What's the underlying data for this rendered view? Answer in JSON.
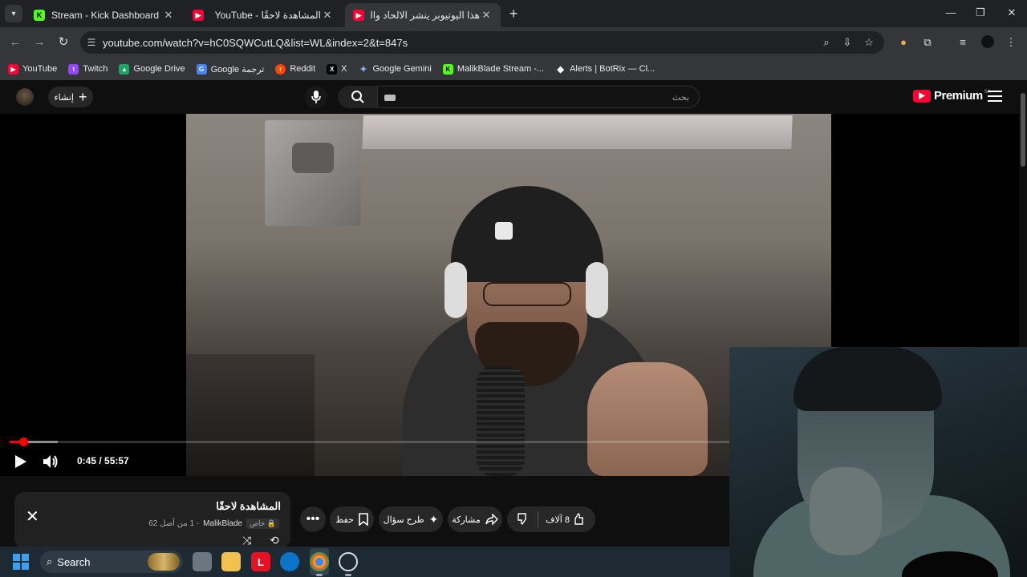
{
  "browser": {
    "tabs": [
      {
        "title": "Stream - Kick Dashboard",
        "favicon": "K",
        "color": "#53fc18",
        "active": false
      },
      {
        "title": "YouTube - المشاهدة لاحقًا",
        "favicon": "▶",
        "color": "#ff0033",
        "active": false
      },
      {
        "title": "هذا اليوتيوبر ينشر الالحاد والشذوذ",
        "favicon": "▶",
        "color": "#ff0033",
        "active": true
      }
    ],
    "url": "youtube.com/watch?v=hC0SQWCutLQ&list=WL&index=2&t=847s",
    "bookmarks": [
      {
        "label": "YouTube",
        "icon": "youtube-icon",
        "color": "#ff0033",
        "glyph": "▶"
      },
      {
        "label": "Twitch",
        "icon": "twitch-icon",
        "color": "#9146ff",
        "glyph": "t"
      },
      {
        "label": "Google Drive",
        "icon": "google-drive-icon",
        "color": "#1fa463",
        "glyph": "▲"
      },
      {
        "label": "Google ترجمة",
        "icon": "google-translate-icon",
        "color": "#4285f4",
        "glyph": "G"
      },
      {
        "label": "Reddit",
        "icon": "reddit-icon",
        "color": "#ff4500",
        "glyph": "r"
      },
      {
        "label": "X",
        "icon": "x-icon",
        "color": "#000000",
        "glyph": "X"
      },
      {
        "label": "Google Gemini",
        "icon": "gemini-icon",
        "color": "#4a7bf7",
        "glyph": "✦"
      },
      {
        "label": "MalikBlade Stream -...",
        "icon": "kick-icon",
        "color": "#53fc18",
        "glyph": "K"
      },
      {
        "label": "Alerts | BotRix — Cl...",
        "icon": "botrix-icon",
        "color": "#444444",
        "glyph": "◆"
      }
    ]
  },
  "youtube": {
    "create_label": "إنشاء",
    "search_placeholder": "بحث",
    "logo_text": "Premium",
    "region": "SA",
    "player": {
      "time": "0:45 / 55:57",
      "progress": 0.0134
    },
    "playlist": {
      "title": "المشاهدة لاحقًا",
      "privacy": "خاص",
      "owner": "MalikBlade",
      "position": "- 1 من أصل 62"
    },
    "actions": {
      "likes": "8 آلاف",
      "share": "مشاركة",
      "ask": "طرح سؤال",
      "save": "حفظ"
    }
  },
  "taskbar": {
    "search_label": "Search"
  }
}
